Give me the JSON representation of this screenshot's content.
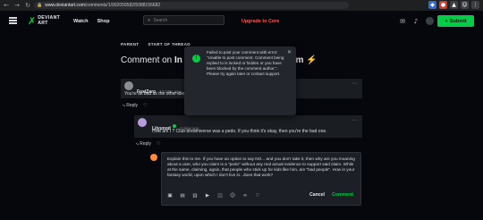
{
  "browser": {
    "url_host": "www.deviantart.com",
    "url_path": "/comments/1/902059582/5088156682",
    "back_icon": "back-arrow-icon",
    "forward_icon": "forward-arrow-icon",
    "reload_icon": "reload-icon"
  },
  "header": {
    "logo_line1": "DEVIANT",
    "logo_line2": "ART",
    "nav": [
      "Watch",
      "Shop"
    ],
    "search_placeholder": "Search",
    "upgrade_label": "Upgrade to Core",
    "submit_label": "Submit",
    "accent": "#05cc47",
    "upgrade_color": "#ff5a4d"
  },
  "thread": {
    "tabs": [
      "PARENT",
      "START OF THREAD"
    ],
    "title_prefix": "Comment on",
    "title_bold": "In r",
    "title_tail": "am ⚡"
  },
  "toast": {
    "icon": "!",
    "message": "Failed to post your comment with error: \"Unable to post comment. Comment being replied to is locked or hidden or you have been blocked by the comment author.\". Please try again later or contact support.",
    "close": "✕"
  },
  "comments": [
    {
      "user": "FoxiZero",
      "time": "13 mins ago",
      "body": "You're as bad as the other idiot who claimed Club was \"evil\" lol",
      "reply_label": "Reply",
      "avatar_color": "#8a8f96"
    },
    {
      "user": "Lilyunod",
      "time": "4 mins ago",
      "body": "How am I ? Club-dreamiverse was a pedo. If you think it's okay, then you're the bad one.",
      "reply_label": "Reply",
      "avatar_color": "#b99be0"
    }
  ],
  "reply": {
    "text": "Explain this to me. If you have an option to say NO... and you don't take it, then why are you moaning about a user, who you claim is a \"pedo\" without any real actual evidence to support said claim. While at the same, claiming, again, that people who stick up for kids like him, are \"bad people\". How in your fantasy world, upon which I don't live in.. does that work?",
    "cancel_label": "Cancel",
    "comment_label": "Comment",
    "toolbar_icons": [
      "image-icon",
      "gallery-icon",
      "poll-icon",
      "video-icon",
      "gif-icon",
      "emoji-icon",
      "link-icon",
      "heart-icon"
    ]
  }
}
